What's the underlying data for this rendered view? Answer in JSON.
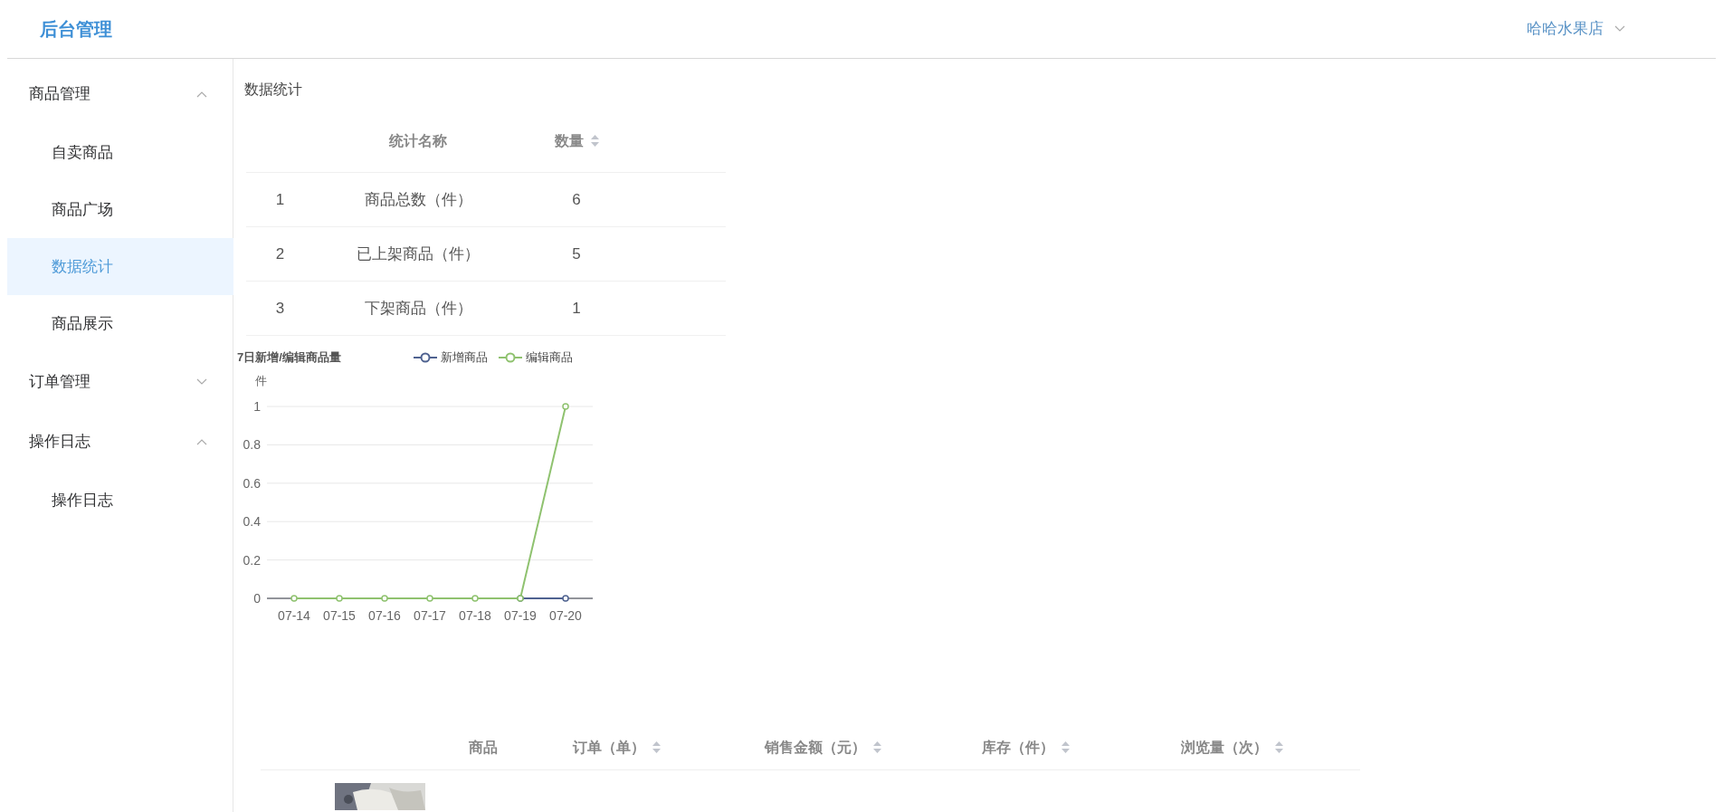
{
  "header": {
    "title": "后台管理",
    "user": "哈哈水果店"
  },
  "sidebar": {
    "groups": [
      {
        "label": "商品管理",
        "expanded": true,
        "items": [
          {
            "label": "自卖商品",
            "selected": false
          },
          {
            "label": "商品广场",
            "selected": false
          },
          {
            "label": "数据统计",
            "selected": true
          },
          {
            "label": "商品展示",
            "selected": false
          }
        ]
      },
      {
        "label": "订单管理",
        "expanded": false
      },
      {
        "label": "操作日志",
        "expanded": true,
        "items": [
          {
            "label": "操作日志",
            "selected": false
          }
        ]
      }
    ]
  },
  "page_title": "数据统计",
  "stats_table": {
    "columns": [
      {
        "label": "统计名称",
        "sortable": false
      },
      {
        "label": "数量",
        "sortable": true
      }
    ],
    "rows": [
      {
        "index": "1",
        "name": "商品总数（件）",
        "count": "6"
      },
      {
        "index": "2",
        "name": "已上架商品（件）",
        "count": "5"
      },
      {
        "index": "3",
        "name": "下架商品（件）",
        "count": "1"
      }
    ]
  },
  "chart": {
    "chart_data": {
      "type": "line",
      "title": "7日新增/编辑商品量",
      "ylabel": "件",
      "categories": [
        "07-14",
        "07-15",
        "07-16",
        "07-17",
        "07-18",
        "07-19",
        "07-20"
      ],
      "ylim": [
        0,
        1
      ],
      "yticks": [
        {
          "value": 0,
          "label": "0"
        },
        {
          "value": 0.2,
          "label": "0.2"
        },
        {
          "value": 0.4,
          "label": "0.4"
        },
        {
          "value": 0.6,
          "label": "0.6"
        },
        {
          "value": 0.8,
          "label": "0.8"
        },
        {
          "value": 1,
          "label": "1"
        }
      ],
      "grid": true,
      "legend": true,
      "series": [
        {
          "name": "新增商品",
          "color": "#4f6290",
          "marker": "circle",
          "values": [
            null,
            null,
            null,
            null,
            null,
            0,
            0
          ]
        },
        {
          "name": "编辑商品",
          "color": "#8fc26f",
          "marker": "circle",
          "values": [
            0,
            0,
            0,
            0,
            0,
            0,
            1
          ]
        }
      ]
    }
  },
  "product_table": {
    "columns": [
      {
        "label": "商品",
        "sortable": false
      },
      {
        "label": "订单（单）",
        "sortable": true
      },
      {
        "label": "销售金额（元）",
        "sortable": true
      },
      {
        "label": "库存（件）",
        "sortable": true
      },
      {
        "label": "浏览量（次）",
        "sortable": true
      }
    ]
  }
}
